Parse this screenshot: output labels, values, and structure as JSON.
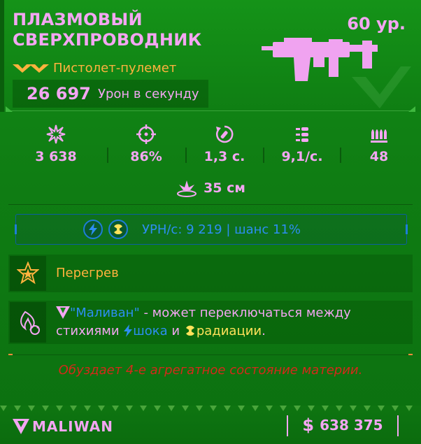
{
  "item": {
    "name": "ПЛАЗМОВЫЙ СВЕРХПРОВОДНИК",
    "level": "60 ур.",
    "type": "Пистолет-пулемет",
    "dps_value": "26 697",
    "dps_label": "Урон в секунду",
    "rarity_color": "#ffb23e",
    "accent_color": "#f3a6f2"
  },
  "stats": [
    {
      "icon": "damage-burst-icon",
      "value": "3 638"
    },
    {
      "icon": "crosshair-icon",
      "value": "86%"
    },
    {
      "icon": "reload-icon",
      "value": "1,3 с."
    },
    {
      "icon": "fire-rate-bullets-icon",
      "value": "9,1/с."
    },
    {
      "icon": "magazine-icon",
      "value": "48"
    }
  ],
  "range": {
    "icon": "splash-radius-icon",
    "value": "35 см"
  },
  "elemental": {
    "icons": [
      "shock-icon",
      "radiation-icon"
    ],
    "text": "УРН/с: 9 219 | шанс 11%",
    "color": "#2d8ef2"
  },
  "perks": [
    {
      "icon": "overheat-star-icon",
      "text": "Перегрев"
    }
  ],
  "manufacturer_perk": {
    "icon": "element-switch-icon",
    "brand_icon": "maliwan-logo-icon",
    "part1": "\"Маливан\"",
    "part2": " - может переключаться между стихиями ",
    "shock_word": "шока",
    "and_word": " и ",
    "rad_word": "радиации",
    "end": "."
  },
  "flavor_text": "Обуздает 4-е агрегатное состояние материи.",
  "footer": {
    "brand": "MALIWAN",
    "currency_icon": "$",
    "price": "638 375"
  }
}
